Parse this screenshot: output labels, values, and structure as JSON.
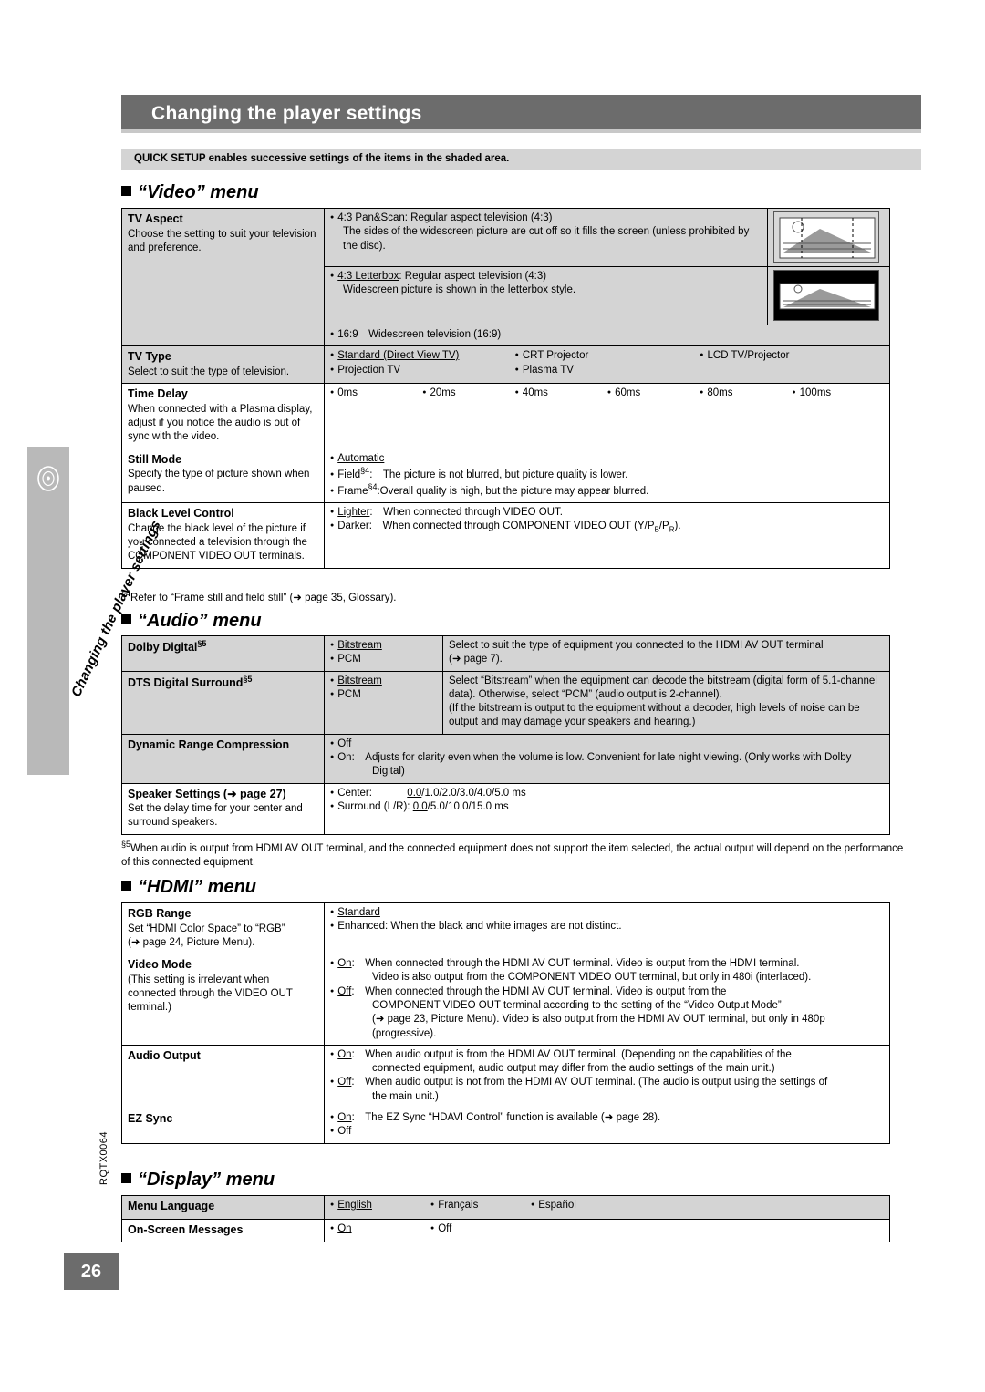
{
  "page": {
    "title": "Changing the player settings",
    "quick_setup_note": "QUICK SETUP enables successive settings of the items in the shaded area.",
    "side_vertical_text": "Changing the player settings",
    "side_code": "RQTX0064",
    "page_number": "26"
  },
  "sections": {
    "video": "“Video” menu",
    "audio": "“Audio” menu",
    "hdmi": "“HDMI” menu",
    "display": "“Display” menu"
  },
  "video": {
    "tv_aspect": {
      "name": "TV Aspect",
      "desc": "Choose the setting to suit your television and preference.",
      "opt1_label": "4:3 Pan&Scan",
      "opt1_text": ": Regular aspect television (4:3)",
      "opt1_body": "The sides of the widescreen picture are cut off so it fills the screen (unless prohibited by the disc).",
      "opt2_label": "4:3 Letterbox",
      "opt2_text": ": Regular aspect television (4:3)",
      "opt2_body": "Widescreen picture is shown in the letterbox style.",
      "opt3": "16:9 Widescreen television (16:9)"
    },
    "tv_type": {
      "name": "TV Type",
      "desc": "Select to suit the type of television.",
      "options": [
        "Standard (Direct View TV)",
        "CRT Projector",
        "LCD TV/Projector",
        "Projection TV",
        "Plasma TV"
      ]
    },
    "time_delay": {
      "name": "Time Delay",
      "desc": "When connected with a Plasma display, adjust if you notice the audio is out of sync with the video.",
      "options": [
        "0ms",
        "20ms",
        "40ms",
        "60ms",
        "80ms",
        "100ms"
      ]
    },
    "still_mode": {
      "name": "Still Mode",
      "desc": "Specify the type of picture shown when paused.",
      "opt1": "Automatic",
      "opt2_label": "Field",
      "opt2_ast": "§4",
      "opt2_text": ": The picture is not blurred, but picture quality is lower.",
      "opt3_label": "Frame",
      "opt3_ast": "§4",
      "opt3_text": ":Overall quality is high, but the picture may appear blurred."
    },
    "black_level": {
      "name": "Black Level Control",
      "desc": "Change the black level of the picture if you connected a television through the COMPONENT VIDEO OUT terminals.",
      "opt1_label": "Lighter",
      "opt1_text": ": When connected through VIDEO OUT.",
      "opt2_label": "Darker",
      "opt2_text": ": When connected through COMPONENT VIDEO OUT (Y/P",
      "opt2_sub1": "B",
      "opt2_mid": "/P",
      "opt2_sub2": "R",
      "opt2_end": ")."
    },
    "footnote4": "Refer to “Frame still and field still” (➜ page 35, Glossary).",
    "footnote4_ast": "§4"
  },
  "audio": {
    "dolby": {
      "name": "Dolby Digital",
      "ast": "§5",
      "opt1": "Bitstream",
      "opt2": "PCM",
      "right1": "Select to suit the type of equipment you connected to the HDMI AV OUT terminal",
      "right2": "(➜ page 7)."
    },
    "dts": {
      "name": "DTS Digital Surround",
      "ast": "§5",
      "opt1": "Bitstream",
      "opt2": "PCM",
      "right1": "Select “Bitstream” when the equipment can decode the bitstream (digital form of 5.1-channel data). Otherwise, select “PCM” (audio output is 2-channel).",
      "right2": "(If the bitstream is output to the equipment without a decoder, high levels of noise can be output and may damage your speakers and hearing.)"
    },
    "drc": {
      "name": "Dynamic Range Compression",
      "opt1": "Off",
      "opt2_label": "On",
      "opt2_text": ": Adjusts for clarity even when the volume is low. Convenient for late night viewing. (Only works with Dolby Digital)"
    },
    "speaker": {
      "name": "Speaker Settings (➜ page 27)",
      "desc": "Set the delay time for your center and surround speakers.",
      "opt1_label": "Center:",
      "opt1_u": "0.0",
      "opt1_text": "/1.0/2.0/3.0/4.0/5.0 ms",
      "opt2_label": "Surround (L/R):",
      "opt2_u": "0.0",
      "opt2_text": "/5.0/10.0/15.0 ms"
    },
    "footnote5_ast": "§5",
    "footnote5": "When audio is output from HDMI AV OUT terminal, and the connected equipment does not support the item selected, the actual output will depend on the performance of this connected equipment."
  },
  "hdmi": {
    "rgb": {
      "name": "RGB Range",
      "desc1": "Set “HDMI Color Space” to “RGB”",
      "desc2": "(➜ page 24, Picture Menu).",
      "opt1": "Standard",
      "opt2": "Enhanced: When the black and white images are not distinct."
    },
    "video_mode": {
      "name": "Video Mode",
      "desc": "(This setting is irrelevant when connected through the VIDEO OUT terminal.)",
      "opt1_label": "On",
      "opt1_text": ": When connected through the HDMI AV OUT terminal. Video is output from the HDMI terminal.",
      "opt1_cont": "Video is also output from the COMPONENT VIDEO OUT terminal, but only in 480i (interlaced).",
      "opt2_label": "Off",
      "opt2_text": ": When connected through the HDMI AV OUT terminal. Video is output from the",
      "opt2_cont1": "COMPONENT VIDEO OUT terminal according to the setting of the “Video Output Mode”",
      "opt2_cont2": "(➜ page 23, Picture Menu). Video is also output from the HDMI AV OUT terminal, but only in 480p",
      "opt2_cont3": "(progressive)."
    },
    "audio_output": {
      "name": "Audio Output",
      "opt1_label": "On",
      "opt1_text": ": When audio output is from the HDMI AV OUT terminal. (Depending on the capabilities of the",
      "opt1_cont": "connected equipment, audio output may differ from the audio settings of the main unit.)",
      "opt2_label": "Off",
      "opt2_text": ": When audio output is not from the HDMI AV OUT terminal. (The audio is output using the settings of",
      "opt2_cont": "the main unit.)"
    },
    "ez_sync": {
      "name": "EZ Sync",
      "opt1_label": "On",
      "opt1_text": ": The EZ Sync “HDAVI Control” function is available (➜ page 28).",
      "opt2": "Off"
    }
  },
  "display": {
    "menu_language": {
      "name": "Menu Language",
      "options": [
        "English",
        "Français",
        "Español"
      ]
    },
    "osd": {
      "name": "On-Screen Messages",
      "options": [
        "On",
        "Off"
      ]
    }
  }
}
